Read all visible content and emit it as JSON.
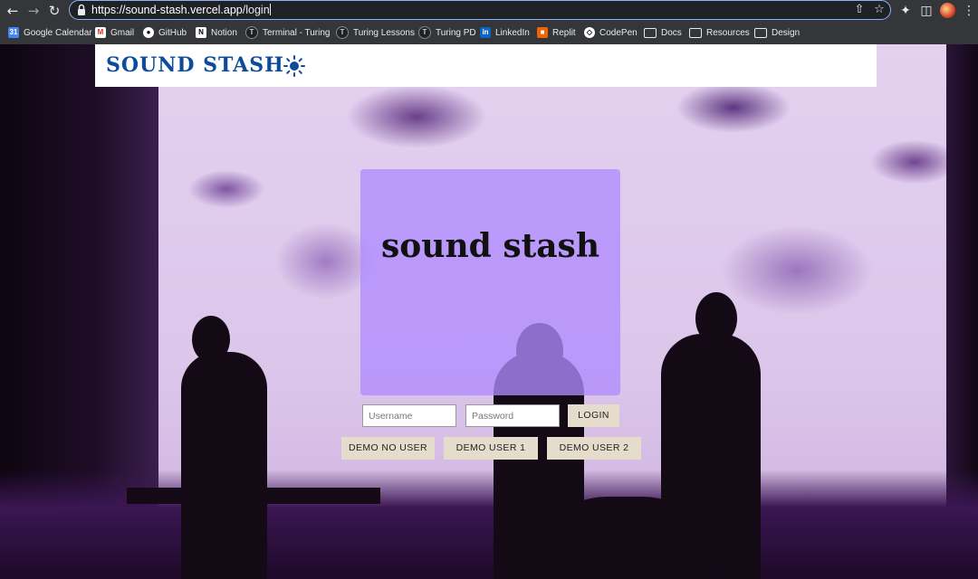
{
  "browser": {
    "url_host": "https://sound-stash.vercel.app",
    "url_path": "/login",
    "bookmarks": [
      {
        "label": "Google Calendar",
        "icon": "calendar-icon"
      },
      {
        "label": "Gmail",
        "icon": "gmail-icon"
      },
      {
        "label": "GitHub",
        "icon": "github-icon"
      },
      {
        "label": "Notion",
        "icon": "notion-icon"
      },
      {
        "label": "Terminal - Turing",
        "icon": "turing-icon"
      },
      {
        "label": "Turing Lessons",
        "icon": "turing-icon"
      },
      {
        "label": "Turing PD",
        "icon": "turing-icon"
      },
      {
        "label": "LinkedIn",
        "icon": "linkedin-icon"
      },
      {
        "label": "Replit",
        "icon": "replit-icon"
      },
      {
        "label": "CodePen",
        "icon": "codepen-icon"
      },
      {
        "label": "Docs",
        "icon": "folder-icon"
      },
      {
        "label": "Resources",
        "icon": "folder-icon"
      },
      {
        "label": "Design",
        "icon": "folder-icon"
      }
    ]
  },
  "header": {
    "logo": "SOUND STASH",
    "theme_icon": "sun-icon"
  },
  "login": {
    "title": "sound stash",
    "username_placeholder": "Username",
    "password_placeholder": "Password",
    "login_label": "LOGIN",
    "demo_buttons": [
      "DEMO NO USER",
      "DEMO USER 1",
      "DEMO USER 2"
    ]
  },
  "colors": {
    "logo_blue": "#0d4c9c",
    "card_purple": "#af8cff",
    "button_beige": "#e5dccb",
    "backdrop_purple": "#5e3680"
  }
}
